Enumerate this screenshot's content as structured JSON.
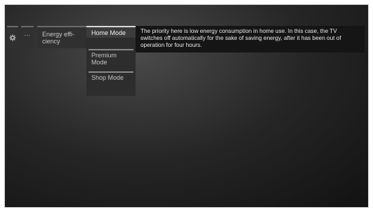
{
  "menu": {
    "settings_icon": "gear-icon",
    "more_label": "···",
    "energy_label": "Energy effi-\nciency"
  },
  "submenu": {
    "items": [
      {
        "label": "Home Mode",
        "selected": true
      },
      {
        "label": "Premium\nMode",
        "selected": false
      },
      {
        "label": "Shop Mode",
        "selected": false
      }
    ]
  },
  "tooltip": {
    "text": "The priority here is low energy consumption in home use. In this case, the TV switches off automatically for the sake of saving energy, after it has been out of operation for four hours."
  }
}
